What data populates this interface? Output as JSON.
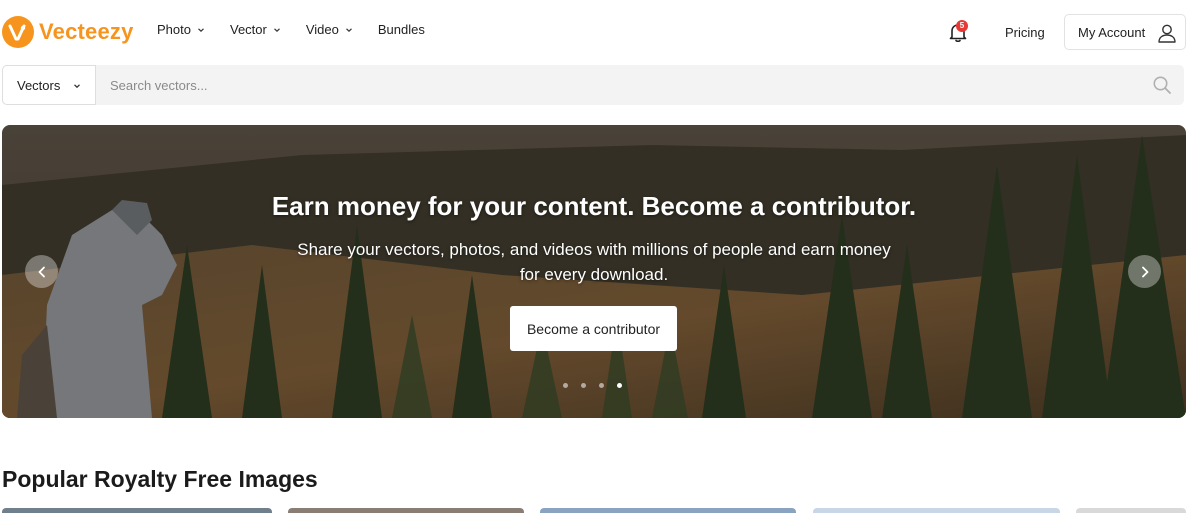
{
  "header": {
    "logo_text": "Vecteezy",
    "nav": [
      {
        "label": "Photo",
        "has_dropdown": true
      },
      {
        "label": "Vector",
        "has_dropdown": true
      },
      {
        "label": "Video",
        "has_dropdown": true
      },
      {
        "label": "Bundles",
        "has_dropdown": false
      }
    ],
    "notification_count": "5",
    "pricing_label": "Pricing",
    "account_label": "My Account"
  },
  "search": {
    "type_selected": "Vectors",
    "placeholder": "Search vectors..."
  },
  "hero": {
    "heading": "Earn money for your content. Become a contributor.",
    "subheading": "Share your vectors, photos, and videos with millions of people and earn money for every download.",
    "button_label": "Become a contributor",
    "slide_count": 4,
    "active_slide": 4
  },
  "section": {
    "title": "Popular Royalty Free Images"
  },
  "colors": {
    "brand": "#f7941d",
    "badge": "#e53935"
  }
}
